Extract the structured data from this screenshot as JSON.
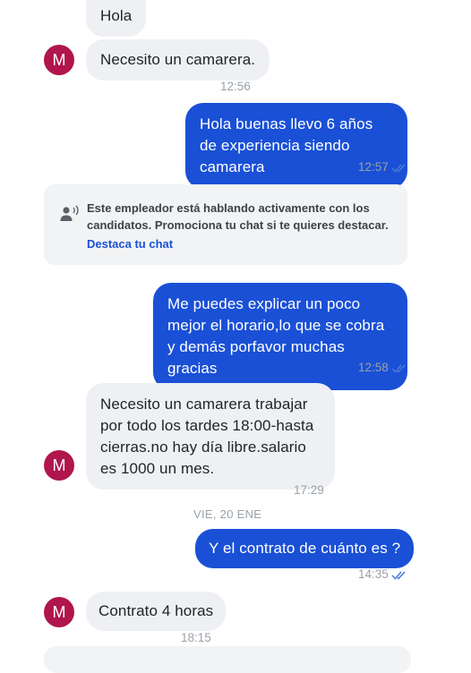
{
  "messages": [
    {
      "text": "Hola"
    },
    {
      "text": "Necesito un camarera."
    },
    {
      "text": "Hola buenas llevo 6 años de experiencia siendo camarera"
    },
    {
      "text": "Me puedes explicar un poco mejor el horario,lo que se cobra y demás porfavor muchas gracias"
    },
    {
      "text": "Necesito un camarera trabajar por todo los tardes 18:00-hasta cierras.no hay día libre.salario es 1000 un mes."
    },
    {
      "text": "Y el contrato de cuánto es ?"
    },
    {
      "text": "Contrato 4 horas"
    }
  ],
  "times": [
    "12:56",
    "12:57",
    "12:58",
    "17:29",
    "14:35",
    "18:15"
  ],
  "avatar_letter": "M",
  "day_divider": "VIE, 20 ENE",
  "notice": {
    "text": "Este empleador está hablando activamente con los candidatos. Promociona tu chat si te quieres destacar.",
    "link": "Destaca tu chat"
  },
  "colors": {
    "outgoing_bubble": "#1a50d6",
    "incoming_bubble": "#eef0f3",
    "avatar": "#b0154c",
    "link": "#1a50d6",
    "read_check": "#4a78d8"
  },
  "icons": {
    "read_receipt": "double-check-icon",
    "notice": "person-speaking-icon"
  }
}
